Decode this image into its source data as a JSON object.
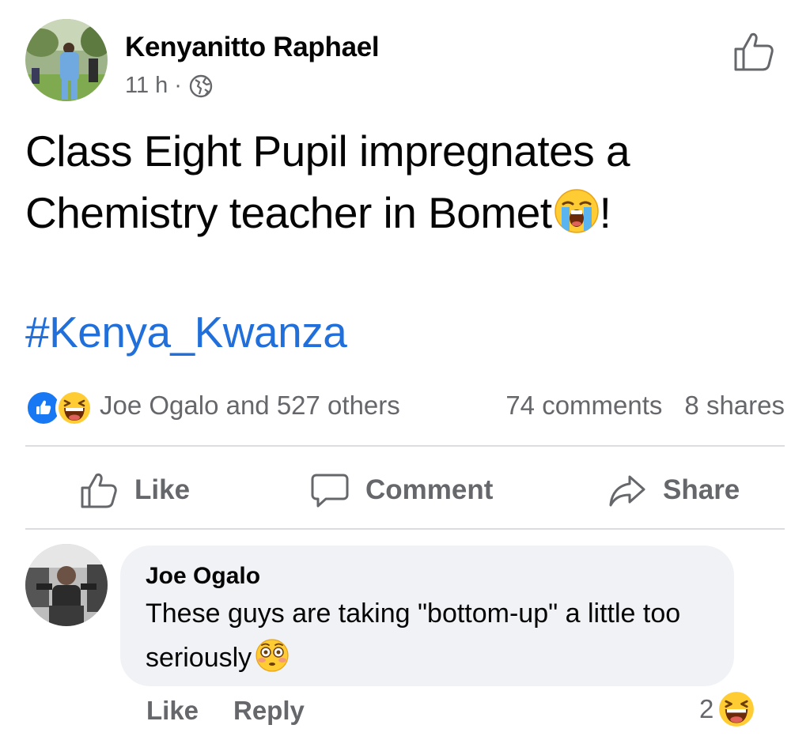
{
  "post": {
    "author": "Kenyanitto Raphael",
    "time": "11 h",
    "separator": "·",
    "privacy_icon": "globe-icon",
    "text_line1": "Class Eight Pupil impregnates a",
    "text_line2_before": "Chemistry teacher in Bomet",
    "text_emoji": "loudly-crying-face",
    "text_line2_after": "!",
    "hashtag": "#Kenya_Kwanza"
  },
  "reactions": {
    "icons": [
      "like",
      "haha"
    ],
    "reactors": "Joe Ogalo and 527 others",
    "comments": "74 comments",
    "shares": "8 shares"
  },
  "actions": {
    "like": "Like",
    "comment": "Comment",
    "share": "Share"
  },
  "comment": {
    "author": "Joe Ogalo",
    "text": "These guys are taking \"bottom-up\" a little too seriously",
    "emoji": "flushed-face",
    "like_label": "Like",
    "reply_label": "Reply",
    "reaction_count": "2",
    "reaction_type": "haha"
  },
  "colors": {
    "hashtag": "#216fdb",
    "secondary_text": "#65676b",
    "like_blue": "#1877f2",
    "bubble_bg": "#f0f2f5"
  }
}
